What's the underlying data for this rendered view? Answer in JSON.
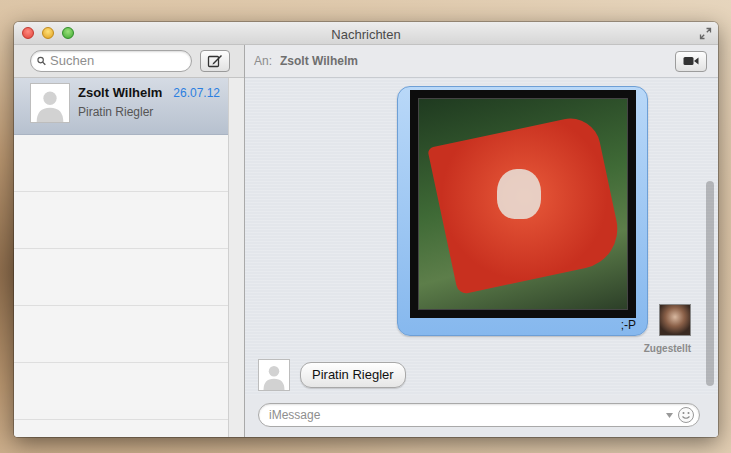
{
  "window": {
    "title": "Nachrichten"
  },
  "search": {
    "placeholder": "Suchen"
  },
  "conversations": [
    {
      "name": "Zsolt Wilhelm",
      "date": "26.07.12",
      "preview": "Piratin Riegler",
      "selected": true
    }
  ],
  "chat": {
    "to_label": "An:",
    "recipient": "Zsolt Wilhelm",
    "messages": [
      {
        "kind": "image",
        "direction": "sent",
        "caption": ";-P",
        "status": "Zugestellt"
      },
      {
        "kind": "text",
        "direction": "received",
        "text": "Piratin Riegler"
      }
    ]
  },
  "composer": {
    "placeholder": "iMessage"
  }
}
